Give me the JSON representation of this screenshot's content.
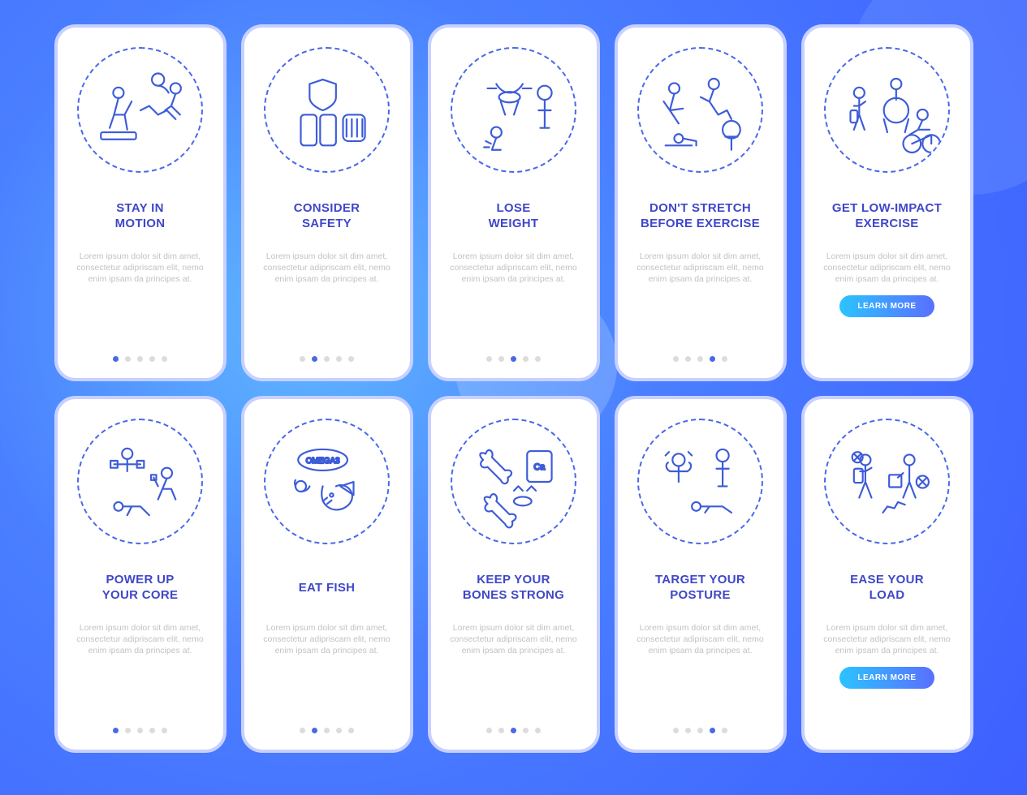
{
  "desc": "Lorem ipsum dolor sit dim amet, consectetur adipriscam elit, nemo enim ipsam da principes at.",
  "button_label": "LEARN MORE",
  "screens": [
    {
      "id": "stay-in-motion",
      "title": "STAY IN\nMOTION",
      "active": 0,
      "button": false,
      "icon": "motion"
    },
    {
      "id": "consider-safety",
      "title": "CONSIDER\nSAFETY",
      "active": 1,
      "button": false,
      "icon": "safety"
    },
    {
      "id": "lose-weight",
      "title": "LOSE\nWEIGHT",
      "active": 2,
      "button": false,
      "icon": "weight"
    },
    {
      "id": "dont-stretch",
      "title": "DON'T STRETCH\nBEFORE EXERCISE",
      "active": 3,
      "button": false,
      "icon": "stretch"
    },
    {
      "id": "low-impact",
      "title": "GET LOW-IMPACT\nEXERCISE",
      "active": null,
      "button": true,
      "icon": "lowimpact"
    },
    {
      "id": "power-core",
      "title": "POWER UP\nYOUR CORE",
      "active": 0,
      "button": false,
      "icon": "core"
    },
    {
      "id": "eat-fish",
      "title": "EAT FISH",
      "active": 1,
      "button": false,
      "icon": "fish"
    },
    {
      "id": "bones-strong",
      "title": "KEEP YOUR\nBONES STRONG",
      "active": 2,
      "button": false,
      "icon": "bones"
    },
    {
      "id": "target-posture",
      "title": "TARGET YOUR\nPOSTURE",
      "active": 3,
      "button": false,
      "icon": "posture"
    },
    {
      "id": "ease-load",
      "title": "EASE YOUR\nLOAD",
      "active": null,
      "button": true,
      "icon": "load"
    }
  ],
  "icons": {
    "motion": "<circle cx='35' cy='30' r='6'/><path d='M35 36 L30 55 L25 70 M30 55 L42 55 M42 55 L50 40 M42 55 L45 72'/><circle cx='80' cy='15' r='7'/><path d='M80 22 C88 22 92 30 92 30'/><rect x='15' y='75' width='40' height='8' rx='2'/><path d='M60 50 L70 45 L80 55 L90 50 L100 60'/><circle cx='100' cy='25' r='6'/><path d='M100 31 L95 45 L105 55 M95 45 L88 50'/>",
    "safety": "<path d='M55 15 L70 20 L70 35 C70 45 55 50 55 50 C55 50 40 45 40 35 L40 20 Z'/><rect x='30' y='55' width='18' height='35' rx='4'/><rect x='52' y='55' width='18' height='35' rx='4'/><rect x='78' y='55' width='25' height='30' rx='6'/><path d='M82 60 L82 80 M88 60 L88 80 M94 60 L94 80 M100 60 L100 80'/>",
    "weight": "<path d='M40 20 C40 20 45 30 55 30 C65 30 70 20 70 20'/><path d='M30 25 L40 25 M80 25 L70 25'/><ellipse cx='55' cy='35' rx='12' ry='6'/><path d='M45 40 L50 55 M65 40 L60 55'/><circle cx='95' cy='30' r='8'/><path d='M95 38 L95 70 M88 50 L102 50 M90 70 L100 70'/><circle cx='40' cy='75' r='6'/><path d='M40 81 L35 95 L45 95 M34 88 L28 85'/><path d='M26 92 L32 92'/>",
    "stretch": "<circle cx='30' cy='25' r='6'/><path d='M30 31 L25 50 L35 65 M25 50 L18 40 M25 50 L40 48'/><circle cx='75' cy='20' r='6'/><path d='M75 26 L70 40 L80 55 M70 40 L60 35 M80 55 L90 50 L95 60'/><circle cx='95' cy='72' r='10'/><path d='M88 80 L102 80 M95 82 L95 95'/><path d='M20 90 L50 90'/><circle cx='35' cy='82' r='5'/><path d='M40 82 L55 85 L55 90'/>",
    "lowimpact": "<circle cx='28' cy='30' r='6'/><path d='M28 36 L28 55 L22 72 M28 55 L34 72 M22 45 L28 45 L35 40'/><rect x='18' y='50' width='8' height='14' rx='2'/><circle cx='70' cy='20' r='6'/><path d='M70 26 L70 38'/><circle cx='70' cy='50' r='14'/><path d='M56 60 L60 75 M84 60 L80 75'/><circle cx='100' cy='55' r='6'/><path d='M100 61 L95 72 L85 78 M95 72 L108 72'/><circle cx='88' cy='88' r='10'/><circle cx='110' cy='88' r='10'/><path d='M88 88 L110 78 L110 88'/>",
    "core": "<circle cx='45' cy='18' r='6'/><path d='M45 24 L45 38 M30 30 L60 30'/><rect x='26' y='26' width='8' height='8'/><rect x='56' y='26' width='8' height='8'/><circle cx='90' cy='40' r='6'/><path d='M90 46 L85 58 L80 70 M85 58 L95 58 L100 70 M80 55 L75 45'/><rect x='72' y='42' width='6' height='6'/><circle cx='35' cy='78' r='5'/><path d='M40 78 L60 78 L70 88 M50 78 L45 88'/>",
    "fish": "<ellipse cx='55' cy='25' rx='28' ry='12'/><text x='55' y='29' font-size='9' text-anchor='middle' fill='#3d5cd8' stroke='none'>OMEGA3</text><circle cx='30' cy='55' r='6'/><path d='M30 61 C38 61 40 55 40 55 M24 55 C24 55 22 50 24 48'/><path d='M55 55 C55 55 50 70 60 78 C70 86 85 80 88 70 C91 60 80 50 70 55'/><path d='M75 55 L90 50 L90 65 Z'/><circle cx='65' cy='65' r='2'/><path d='M55 72 L60 68 M60 75 L65 71'/>",
    "bones": "<path d='M25 25 C20 20 20 15 28 18 C30 10 38 15 35 22 L50 37 C58 35 60 42 53 45 C55 52 48 55 45 48 L30 33 C22 36 20 28 25 25 Z'/><rect x='75' y='15' width='28' height='35' rx='4'/><text x='89' y='36' font-size='10' text-anchor='middle' fill='#3d5cd8' stroke='none'>Ca</text><path d='M60 60 L65 55 L70 60 M75 60 L80 55 L85 60'/><ellipse cx='70' cy='72' rx='10' ry='5'/><path d='M30 75 C25 70 25 65 33 68 C35 60 43 65 40 72 L55 87 C63 85 65 92 58 95 C60 102 53 105 50 98 L35 83 C27 86 25 78 30 75 Z'/>",
    "posture": "<circle cx='35' cy='25' r='7'/><path d='M35 32 L35 50 M25 38 L45 38 M25 38 C20 35 20 30 23 28 M45 38 C50 35 50 30 47 28'/><path d='M20 20 L24 16 M50 20 L46 16'/><circle cx='85' cy='20' r='7'/><path d='M85 27 L85 55 M78 35 L92 35 M80 55 L90 55'/><path d='M85 30 L85 50' stroke-dasharray='2,2'/><circle cx='55' cy='78' r='5'/><path d='M60 78 L85 78 L95 85 M70 78 L65 85'/>",
    "load": "<circle cx='35' cy='25' r='6'/><path d='M35 31 L35 50 L28 68 M35 50 L42 68 M29 38 L35 38 L42 34'/><rect x='22' y='35' width='10' height='16' rx='2'/><circle cx='26' cy='22' r='6'/><path d='M22 18 L30 26 M30 18 L22 26' stroke='#fff'/><path d='M24 20 L28 24' /><circle cx='85' cy='25' r='6'/><path d='M85 31 L85 50 L78 68 M85 50 L92 68 M78 40 L72 45'/><rect x='62' y='42' width='14' height='14' rx='1'/><circle cx='100' cy='50' r='7'/><path d='M96 46 L104 54 M104 46 L96 54'/><path d='M55 85 L60 78 L68 80 L72 73 L80 76' />"
  }
}
